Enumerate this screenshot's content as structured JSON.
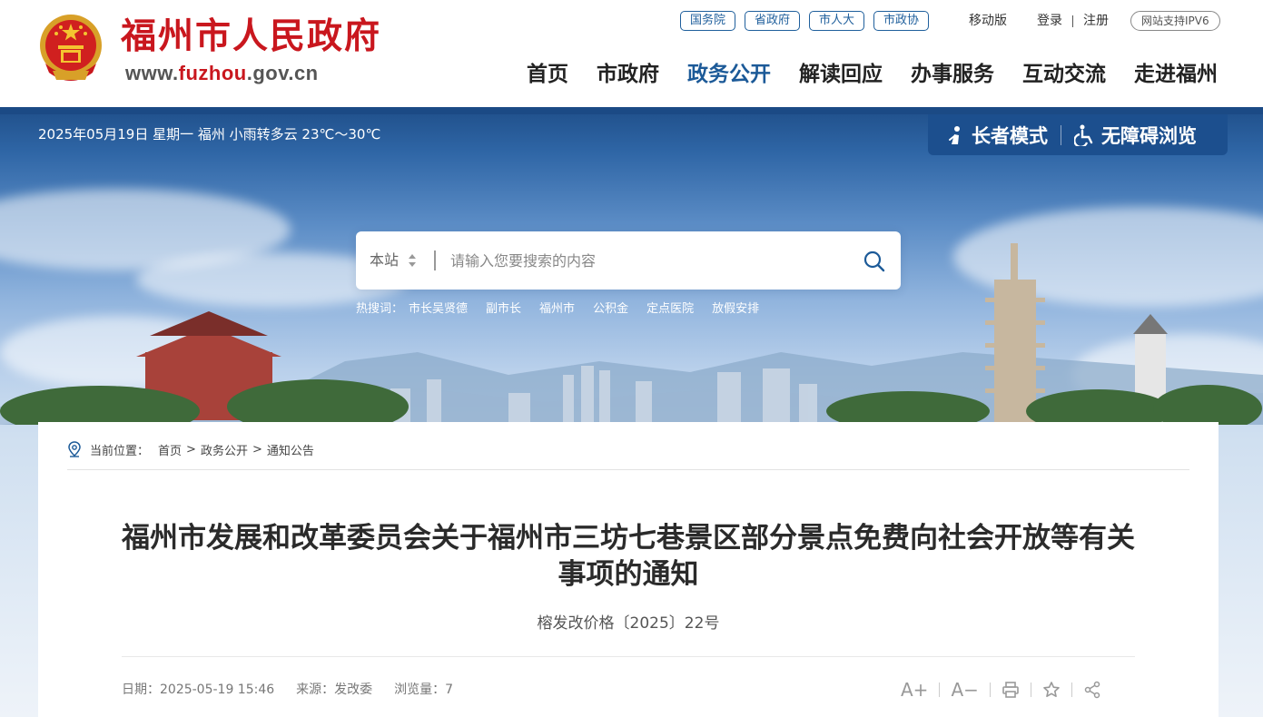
{
  "header": {
    "site_name": "福州市人民政府",
    "site_url_prefix": "www.",
    "site_url_highlight": "fuzhou",
    "site_url_suffix": ".gov.cn",
    "top_links": [
      "国务院",
      "省政府",
      "市人大",
      "市政协"
    ],
    "mobile_label": "移动版",
    "login_label": "登录",
    "register_label": "注册",
    "ipv6_label": "网站支持IPV6",
    "nav": [
      "首页",
      "市政府",
      "政务公开",
      "解读回应",
      "办事服务",
      "互动交流",
      "走进福州"
    ],
    "active_nav": "政务公开",
    "brand_red": "#c9171e",
    "brand_blue": "#1c5a98"
  },
  "banner": {
    "weather": "2025年05月19日 星期一   福州 小雨转多云 23℃～30℃",
    "elder_mode_label": "长者模式",
    "accessibility_label": "无障碍浏览",
    "search": {
      "scope_label": "本站",
      "placeholder": "请输入您要搜索的内容"
    },
    "hot_label": "热搜词：",
    "hot_words": [
      "市长吴贤德",
      "副市长",
      "福州市",
      "公积金",
      "定点医院",
      "放假安排"
    ]
  },
  "article": {
    "breadcrumb_label": "当前位置：",
    "breadcrumb": [
      "首页",
      "政务公开",
      "通知公告"
    ],
    "title": "福州市发展和改革委员会关于福州市三坊七巷景区部分景点免费向社会开放等有关事项的通知",
    "doc_number": "榕发改价格〔2025〕22号",
    "date_label": "日期：",
    "date": "2025-05-19 15:46",
    "source_label": "来源：",
    "source": "发改委",
    "views_label": "浏览量：",
    "views": "7",
    "tools": {
      "font_larger": "A+",
      "font_smaller": "A−"
    }
  }
}
